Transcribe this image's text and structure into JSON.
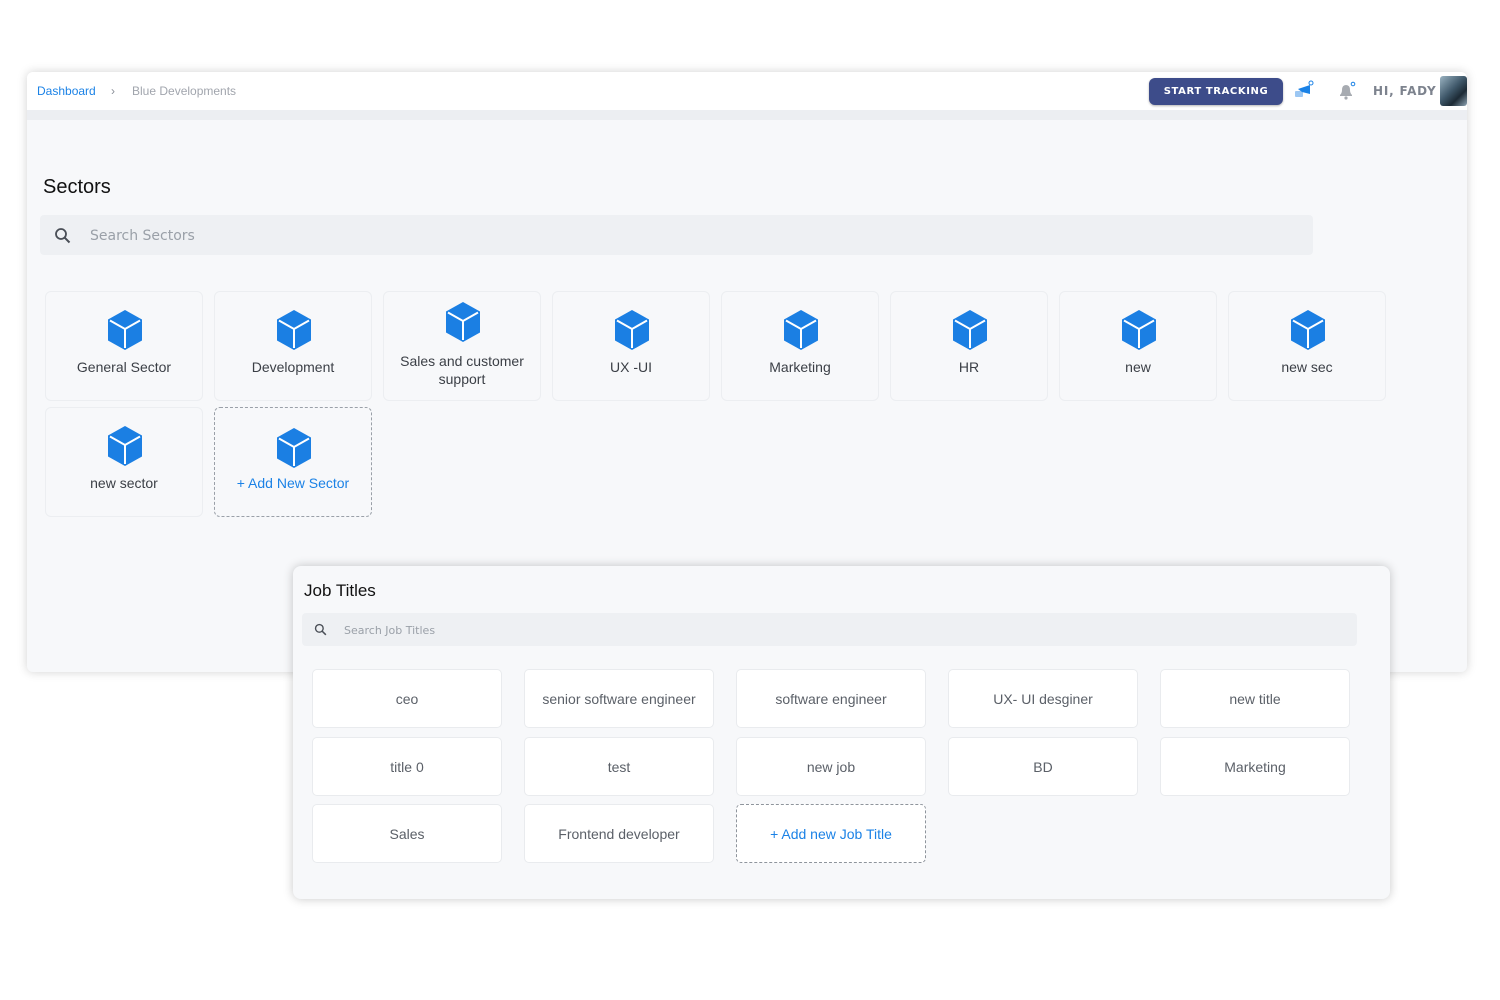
{
  "header": {
    "breadcrumb": {
      "root": "Dashboard",
      "separator": "›",
      "current": "Blue Developments"
    },
    "start_tracking_label": "START TRACKING",
    "greeting": "HI, FADY",
    "icons": {
      "tracker": "tracker-icon",
      "notifications": "bell-icon",
      "avatar": "user-avatar"
    }
  },
  "sectors": {
    "title": "Sectors",
    "search_placeholder": "Search Sectors",
    "items": [
      {
        "label": "General Sector"
      },
      {
        "label": "Development"
      },
      {
        "label": "Sales and customer support"
      },
      {
        "label": "UX -UI"
      },
      {
        "label": "Marketing"
      },
      {
        "label": "HR"
      },
      {
        "label": "new"
      },
      {
        "label": "new sec"
      },
      {
        "label": "new sector"
      }
    ],
    "add_label": "+ Add New Sector",
    "icon": "cube-icon",
    "icon_color": "#1b7fe3"
  },
  "job_titles": {
    "title": "Job Titles",
    "search_placeholder": "Search Job Titles",
    "items": [
      {
        "label": "ceo"
      },
      {
        "label": "senior software engineer"
      },
      {
        "label": "software engineer"
      },
      {
        "label": "UX- UI desginer"
      },
      {
        "label": "new title"
      },
      {
        "label": "title 0"
      },
      {
        "label": "test"
      },
      {
        "label": "new job"
      },
      {
        "label": "BD"
      },
      {
        "label": "Marketing"
      },
      {
        "label": "Sales"
      },
      {
        "label": "Frontend developer"
      }
    ],
    "add_label": "+ Add new Job Title"
  },
  "colors": {
    "accent": "#1b82e6",
    "primary_button": "#3d4c8a",
    "card_bg": "#f7f8fa",
    "search_bg": "#eef0f3"
  }
}
